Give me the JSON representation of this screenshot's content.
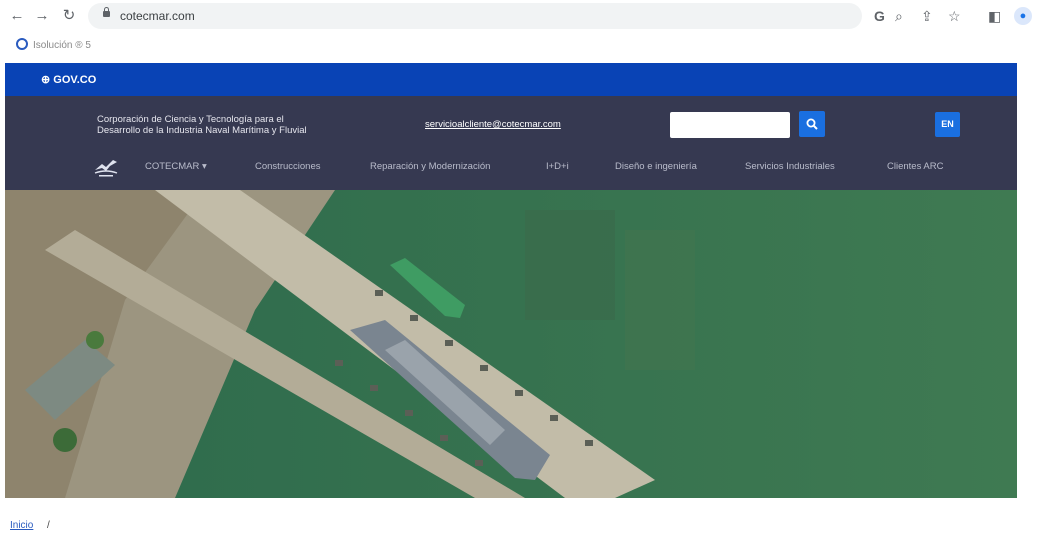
{
  "browser": {
    "url": "cotecmar.com",
    "bookmark_label": "Isolución ® 5"
  },
  "gov": {
    "label": "GOV.CO",
    "color": "#0943b5"
  },
  "header": {
    "tagline_line1": "Corporación de Ciencia y Tecnología para el",
    "tagline_line2": "Desarrollo de la Industria Naval Marítima y Fluvial",
    "email": "servicioalcliente@cotecmar.com",
    "search_placeholder": "",
    "lang_button": "EN",
    "bg_color": "#363951",
    "accent": "#1a6fe0"
  },
  "menu": [
    {
      "label": "COTECMAR ▾"
    },
    {
      "label": "Construcciones"
    },
    {
      "label": "Reparación y Modernización"
    },
    {
      "label": "I+D+i"
    },
    {
      "label": "Diseño e ingeniería"
    },
    {
      "label": "Servicios Industriales"
    },
    {
      "label": "Clientes ARC"
    }
  ],
  "breadcrumb": {
    "home": "Inicio",
    "separator": "/"
  }
}
